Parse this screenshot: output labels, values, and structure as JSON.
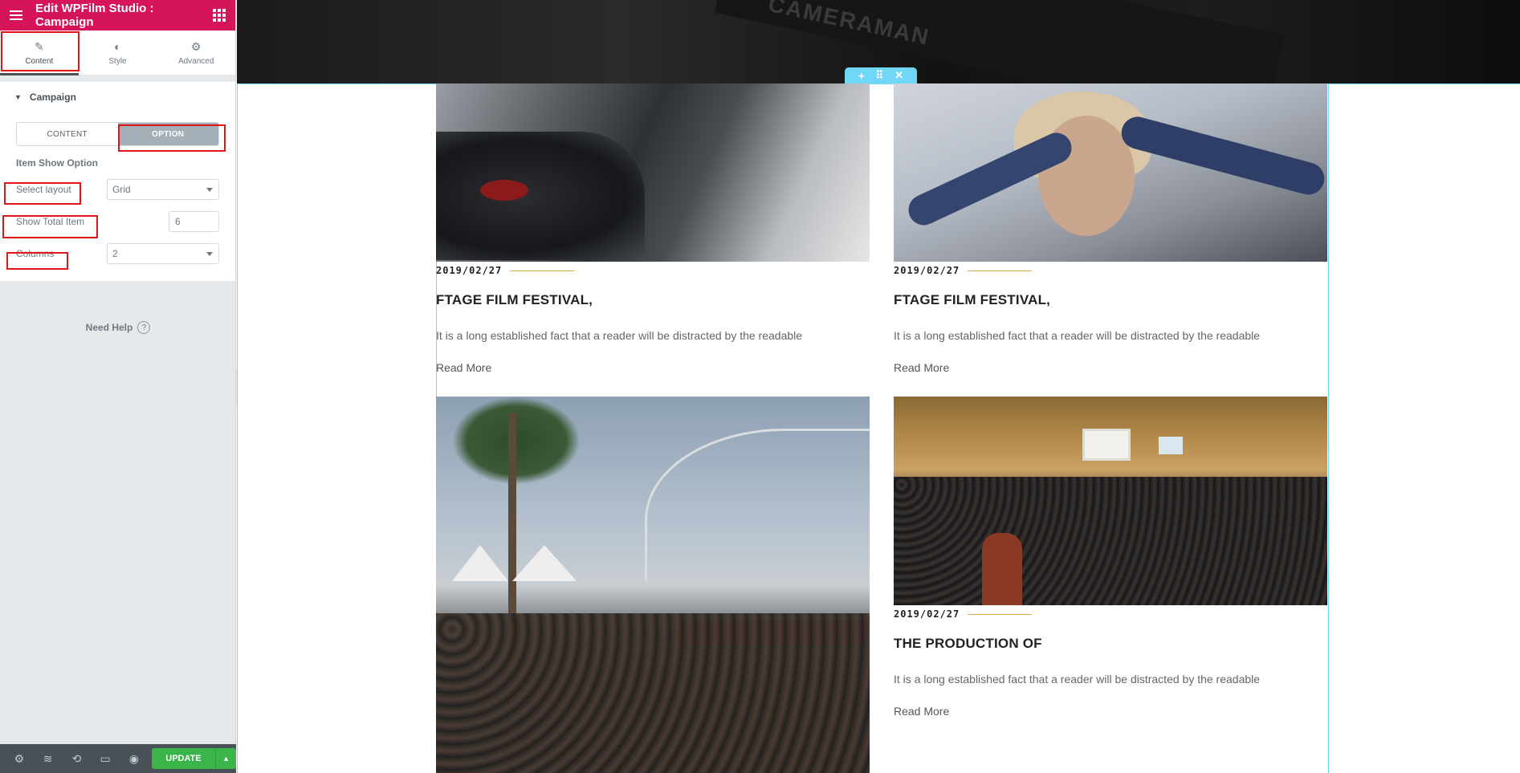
{
  "panel": {
    "title": "Edit WPFilm Studio : Campaign",
    "tabs": [
      {
        "label": "Content",
        "icon": "pencil-icon"
      },
      {
        "label": "Style",
        "icon": "contrast-icon"
      },
      {
        "label": "Advanced",
        "icon": "gear-icon"
      }
    ],
    "section_title": "Campaign",
    "switcher": {
      "content_label": "CONTENT",
      "option_label": "OPTION",
      "selected": "OPTION"
    },
    "heading": "Item Show Option",
    "controls": {
      "layout": {
        "label": "Select layout",
        "value": "Grid"
      },
      "total": {
        "label": "Show Total Item",
        "value": "6"
      },
      "columns": {
        "label": "Columns",
        "value": "2"
      }
    },
    "need_help": "Need Help",
    "footer": {
      "icons": [
        "gear-icon",
        "layers-icon",
        "history-icon",
        "desktop-icon",
        "eye-icon"
      ],
      "update_label": "UPDATE"
    },
    "accent_color": "#d5145a",
    "update_color": "#39b54a"
  },
  "preview": {
    "hero_text": "CAMERAMAN",
    "handle": {
      "add": "+",
      "move": "⠿",
      "close": "✕"
    },
    "cards": [
      {
        "date": "2019/02/27",
        "title": "FTAGE FILM FESTIVAL,",
        "excerpt": "It is a long established fact that a reader will be distracted by the readable",
        "link": "Read More"
      },
      {
        "date": "2019/02/27",
        "title": "FTAGE FILM FESTIVAL,",
        "excerpt": "It is a long established fact that a reader will be distracted by the readable",
        "link": "Read More"
      },
      {
        "date": "",
        "title": "",
        "excerpt": "",
        "link": ""
      },
      {
        "date": "2019/02/27",
        "title": "THE PRODUCTION OF",
        "excerpt": "It is a long established fact that a reader will be distracted by the readable",
        "link": "Read More"
      }
    ]
  }
}
